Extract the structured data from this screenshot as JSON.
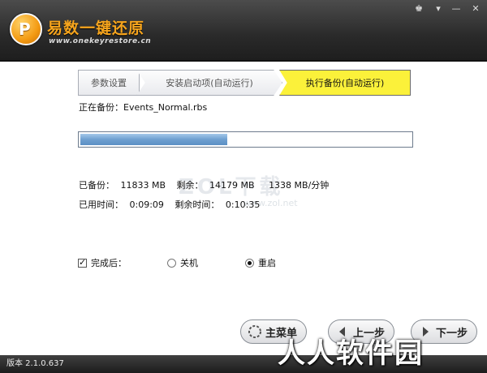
{
  "app": {
    "title": "易数一键还原",
    "url": "www.onekeyrestore.cn",
    "logo_mark": "P"
  },
  "window_controls": {
    "skin": "♚",
    "menu": "▾",
    "minimize": "—",
    "close": "✕"
  },
  "steps": [
    {
      "label": "参数设置"
    },
    {
      "label": "安装启动项(自动运行)"
    },
    {
      "label": "执行备份(自动运行)"
    }
  ],
  "status": {
    "backing_up_label": "正在备份：",
    "file": "Events_Normal.rbs",
    "progress": 0.45
  },
  "stats": {
    "backed_label": "已备份：",
    "backed_value": "11833 MB",
    "remaining_label": "剩余：",
    "remaining_value": "14179 MB",
    "speed_value": "1338 MB/分钟",
    "elapsed_label": "已用时间：",
    "elapsed_value": "0:09:09",
    "left_time_label": "剩余时间：",
    "left_time_value": "0:10:35"
  },
  "after": {
    "checkbox_label": "完成后：",
    "checked": true,
    "options": [
      {
        "label": "关机",
        "selected": false
      },
      {
        "label": "重启",
        "selected": true
      }
    ]
  },
  "buttons": {
    "main_menu": "主菜单",
    "prev": "上一步",
    "next": "下一步"
  },
  "footer": {
    "version": "版本 2.1.0.637"
  },
  "watermarks": {
    "a": "ZOL下载",
    "b": "www.zol.net",
    "c": "人人软件园"
  },
  "colors": {
    "active_step": "#fbf13a",
    "progress": "#6e9fd0",
    "title_orange": "#f7a51d"
  }
}
